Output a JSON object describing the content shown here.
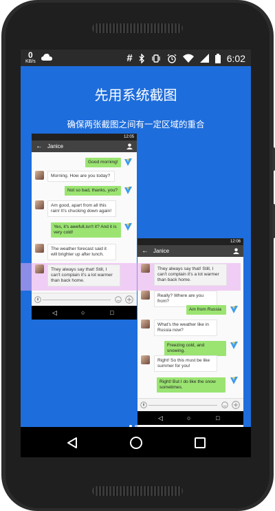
{
  "statusbar": {
    "speed_value": "0",
    "speed_unit": "KB/s",
    "hash_icon": "#",
    "time": "6:02"
  },
  "page": {
    "title": "先用系统截图",
    "subtitle": "确保两张截图之间有一定区域的重合"
  },
  "shot1": {
    "status_time": "12:05",
    "contact": "Janice",
    "messages": [
      {
        "dir": "out",
        "text": "Good morning!"
      },
      {
        "dir": "in",
        "text": "Morning. How are you today?"
      },
      {
        "dir": "out",
        "text": "Not so bad, thanks, you?"
      },
      {
        "dir": "in",
        "text": "Am good, apart from all this rain! It's chucking down again!"
      },
      {
        "dir": "out",
        "text": "Yes, it's awefull,isn't it? And it is very cold!"
      },
      {
        "dir": "in",
        "text": "The weather forecast said it will brighter up after lunch."
      },
      {
        "dir": "in",
        "text": "They always say that! Still, I can't complain it's a lot warmer than back home."
      }
    ]
  },
  "shot2": {
    "status_time": "12:06",
    "contact": "Janice",
    "messages": [
      {
        "dir": "in",
        "text": "They always say that! Still, I can't complain it's a lot warmer than back home."
      },
      {
        "dir": "in",
        "text": "Really? Where are you from?"
      },
      {
        "dir": "out",
        "text": "Am from Russia"
      },
      {
        "dir": "in",
        "text": "What's the weather like in Russia now?"
      },
      {
        "dir": "out",
        "text": "Freezing cold, and snowing."
      },
      {
        "dir": "in",
        "text": "Right! So this must be like summer for you!"
      },
      {
        "dir": "out",
        "text": "Right! But I do like the snow sometimes."
      }
    ]
  },
  "pager": {
    "total": 2,
    "current": 1
  },
  "colors": {
    "background": "#1e6ddc",
    "outgoing_bubble": "#9be472",
    "overlap_highlight": "#e8a7ee",
    "toolbar": "#424242"
  },
  "icons": [
    "bluetooth-icon",
    "vibrate-icon",
    "alarm-icon",
    "wifi-icon",
    "signal-icon",
    "battery-icon",
    "cloud-icon",
    "back-icon",
    "home-icon",
    "recents-icon"
  ]
}
